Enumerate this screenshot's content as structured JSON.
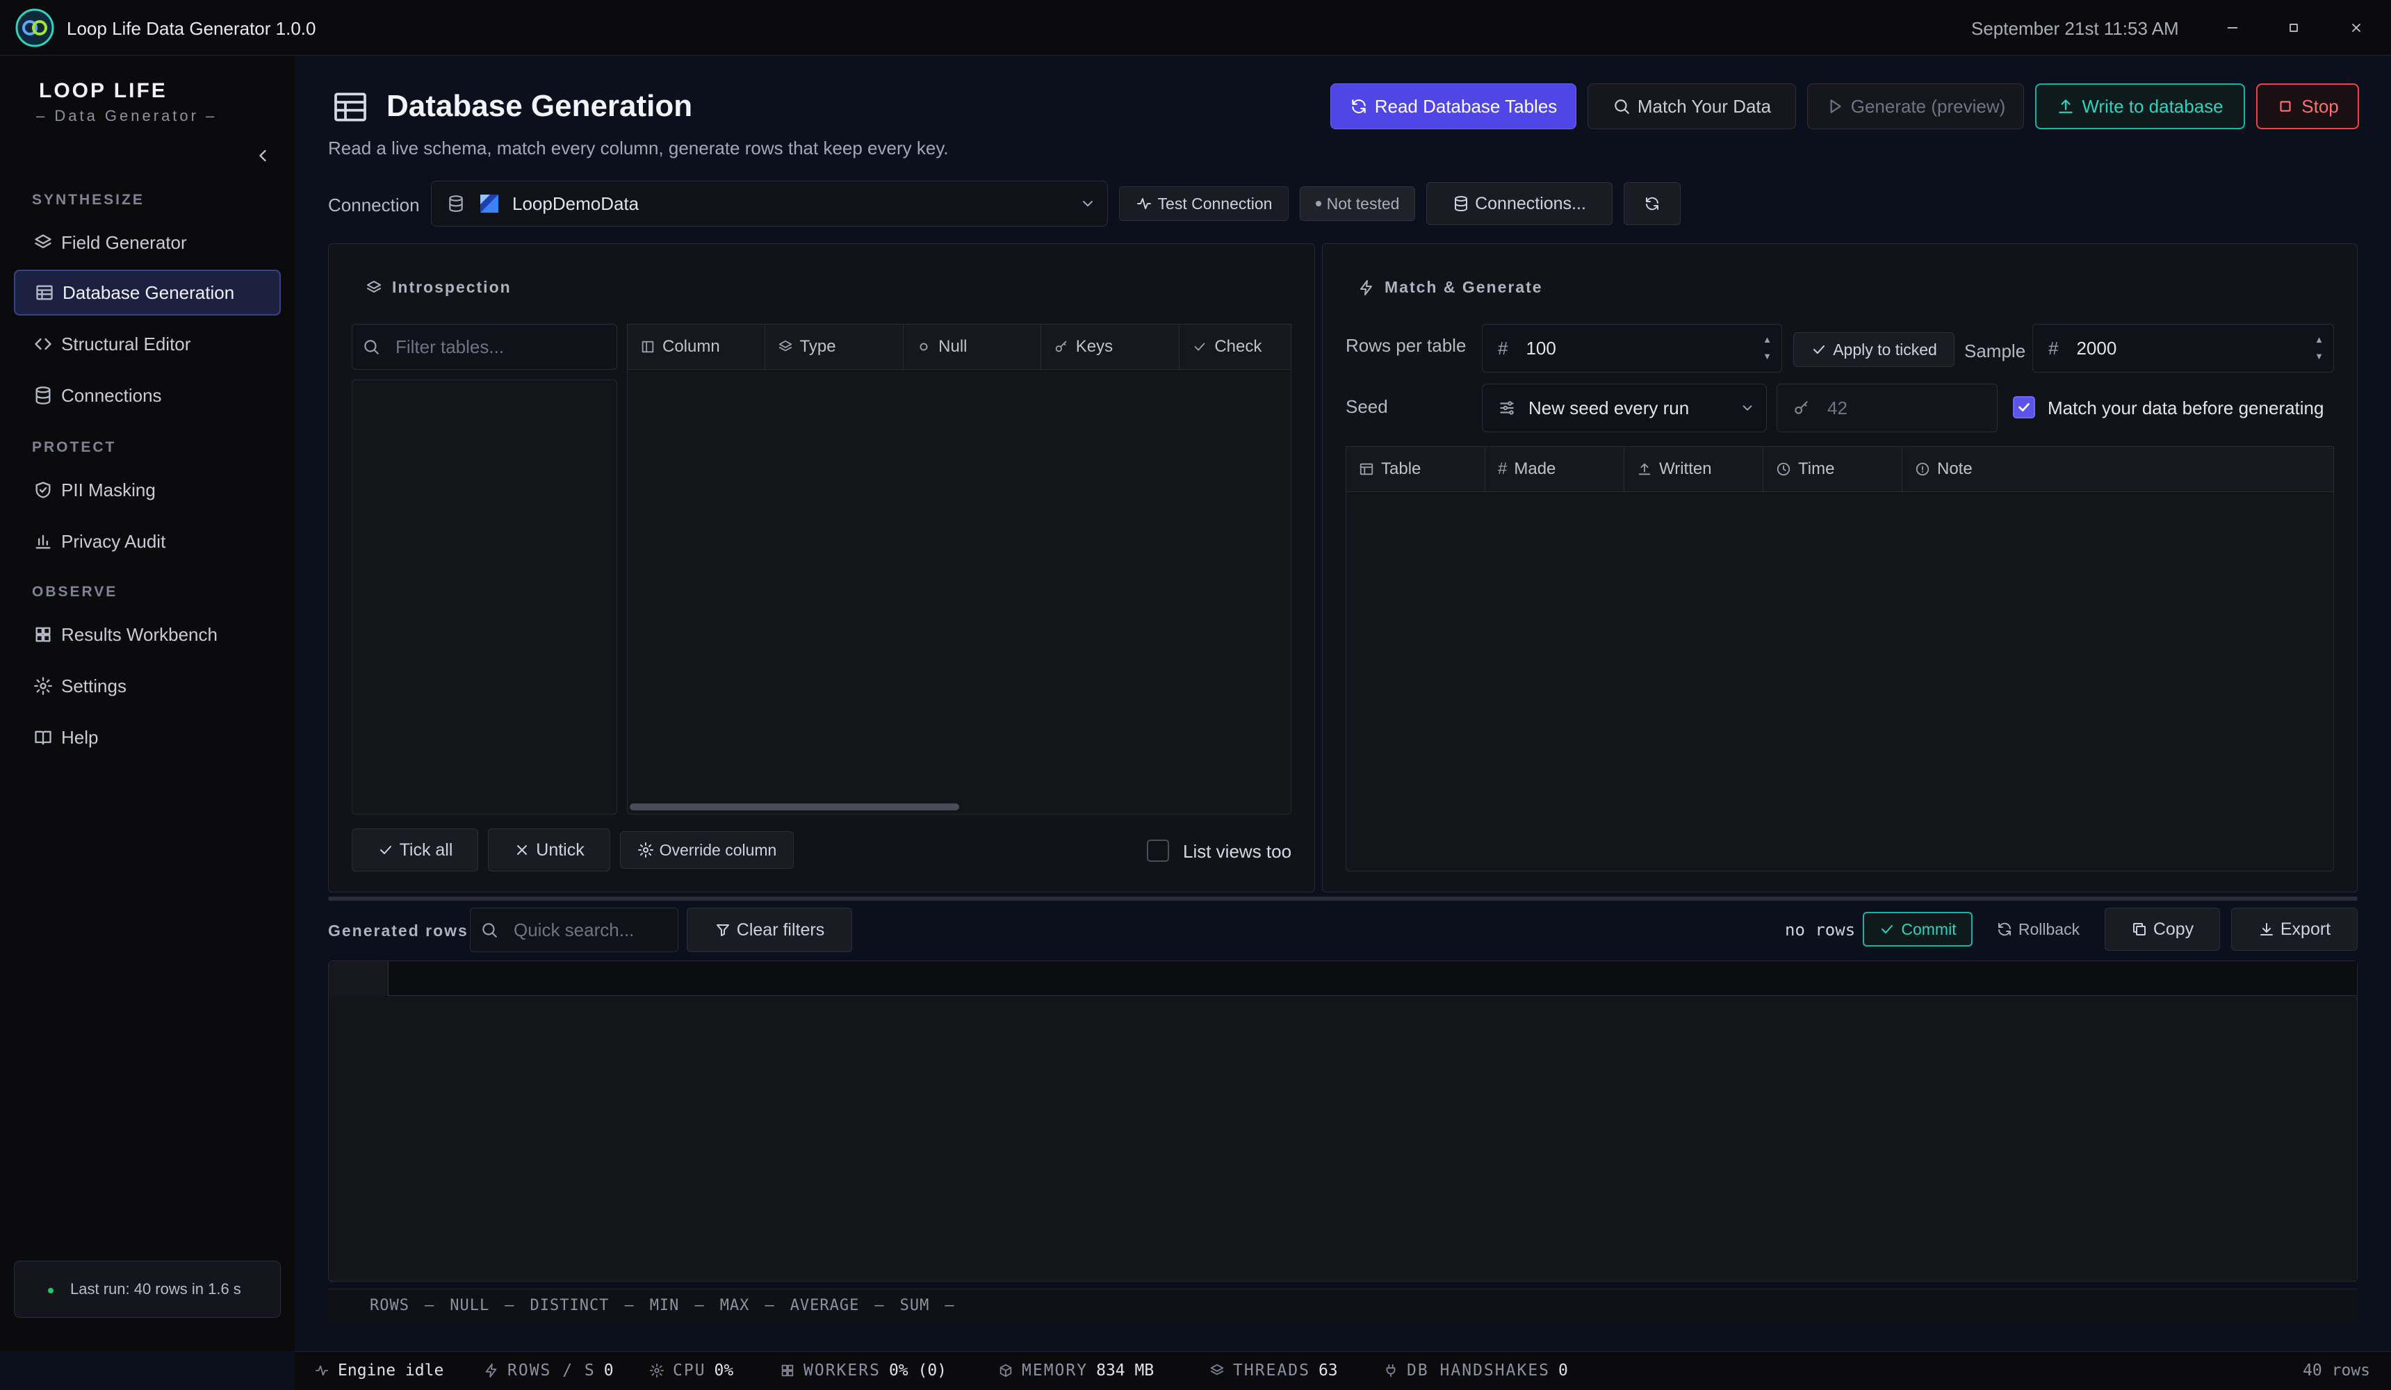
{
  "window": {
    "title": "Loop Life Data Generator 1.0.0",
    "datetime": "September 21st 11:53 AM"
  },
  "sidebar": {
    "brand": "LOOP LIFE",
    "subtitle": "– Data Generator –",
    "sections": {
      "synthesize": "SYNTHESIZE",
      "protect": "PROTECT",
      "observe": "OBSERVE"
    },
    "items": [
      {
        "label": "Field Generator",
        "icon": "layers-icon"
      },
      {
        "label": "Database Generation",
        "icon": "table-icon",
        "active": true
      },
      {
        "label": "Structural Editor",
        "icon": "code-icon"
      },
      {
        "label": "Connections",
        "icon": "database-icon"
      },
      {
        "label": "PII Masking",
        "icon": "shield-check-icon"
      },
      {
        "label": "Privacy Audit",
        "icon": "bar-chart-icon"
      },
      {
        "label": "Results Workbench",
        "icon": "grid-icon"
      },
      {
        "label": "Settings",
        "icon": "gear-icon"
      },
      {
        "label": "Help",
        "icon": "book-icon"
      }
    ],
    "last_run": "Last run: 40 rows in 1.6 s"
  },
  "header": {
    "title": "Database Generation",
    "subtitle": "Read a live schema, match every column, generate rows that keep every key.",
    "buttons": {
      "read": "Read Database Tables",
      "match": "Match Your Data",
      "generate": "Generate (preview)",
      "write": "Write to database",
      "stop": "Stop"
    }
  },
  "connection": {
    "label": "Connection",
    "selected": "LoopDemoData",
    "test": "Test Connection",
    "status": "Not tested",
    "manage": "Connections..."
  },
  "introspection": {
    "title": "Introspection",
    "filter_placeholder": "Filter tables...",
    "columns": [
      "Column",
      "Type",
      "Null",
      "Keys",
      "Check"
    ],
    "tick_all": "Tick all",
    "untick": "Untick",
    "override": "Override column",
    "list_views": "List views too"
  },
  "match_generate": {
    "title": "Match & Generate",
    "rows_label": "Rows per table",
    "rows_value": "100",
    "apply": "Apply to ticked",
    "sample_label": "Sample",
    "sample_value": "2000",
    "seed_label": "Seed",
    "seed_mode": "New seed every run",
    "seed_value": "42",
    "match_checkbox": "Match your data before generating",
    "match_checked": true,
    "columns": [
      "Table",
      "Made",
      "Written",
      "Time",
      "Note"
    ]
  },
  "generated": {
    "label": "Generated rows",
    "search_placeholder": "Quick search...",
    "clear": "Clear filters",
    "count": "no rows",
    "commit": "Commit",
    "rollback": "Rollback",
    "copy": "Copy",
    "export": "Export",
    "stats": [
      {
        "k": "ROWS",
        "v": "–"
      },
      {
        "k": "NULL",
        "v": "–"
      },
      {
        "k": "DISTINCT",
        "v": "–"
      },
      {
        "k": "MIN",
        "v": "–"
      },
      {
        "k": "MAX",
        "v": "–"
      },
      {
        "k": "AVERAGE",
        "v": "–"
      },
      {
        "k": "SUM",
        "v": "–"
      }
    ]
  },
  "statusbar": {
    "engine": "Engine idle",
    "rows_label": "ROWS / S",
    "rows_value": "0",
    "cpu_label": "CPU",
    "cpu_value": "0%",
    "workers_label": "WORKERS",
    "workers_value": "0% (0)",
    "memory_label": "MEMORY",
    "memory_value": "834 MB",
    "threads_label": "THREADS",
    "threads_value": "63",
    "handshakes_label": "DB HANDSHAKES",
    "handshakes_value": "0",
    "total": "40 rows"
  },
  "colors": {
    "accent": "#4f46e5",
    "teal": "#14b8a6",
    "danger": "#ef4444",
    "ok": "#22c55e"
  }
}
